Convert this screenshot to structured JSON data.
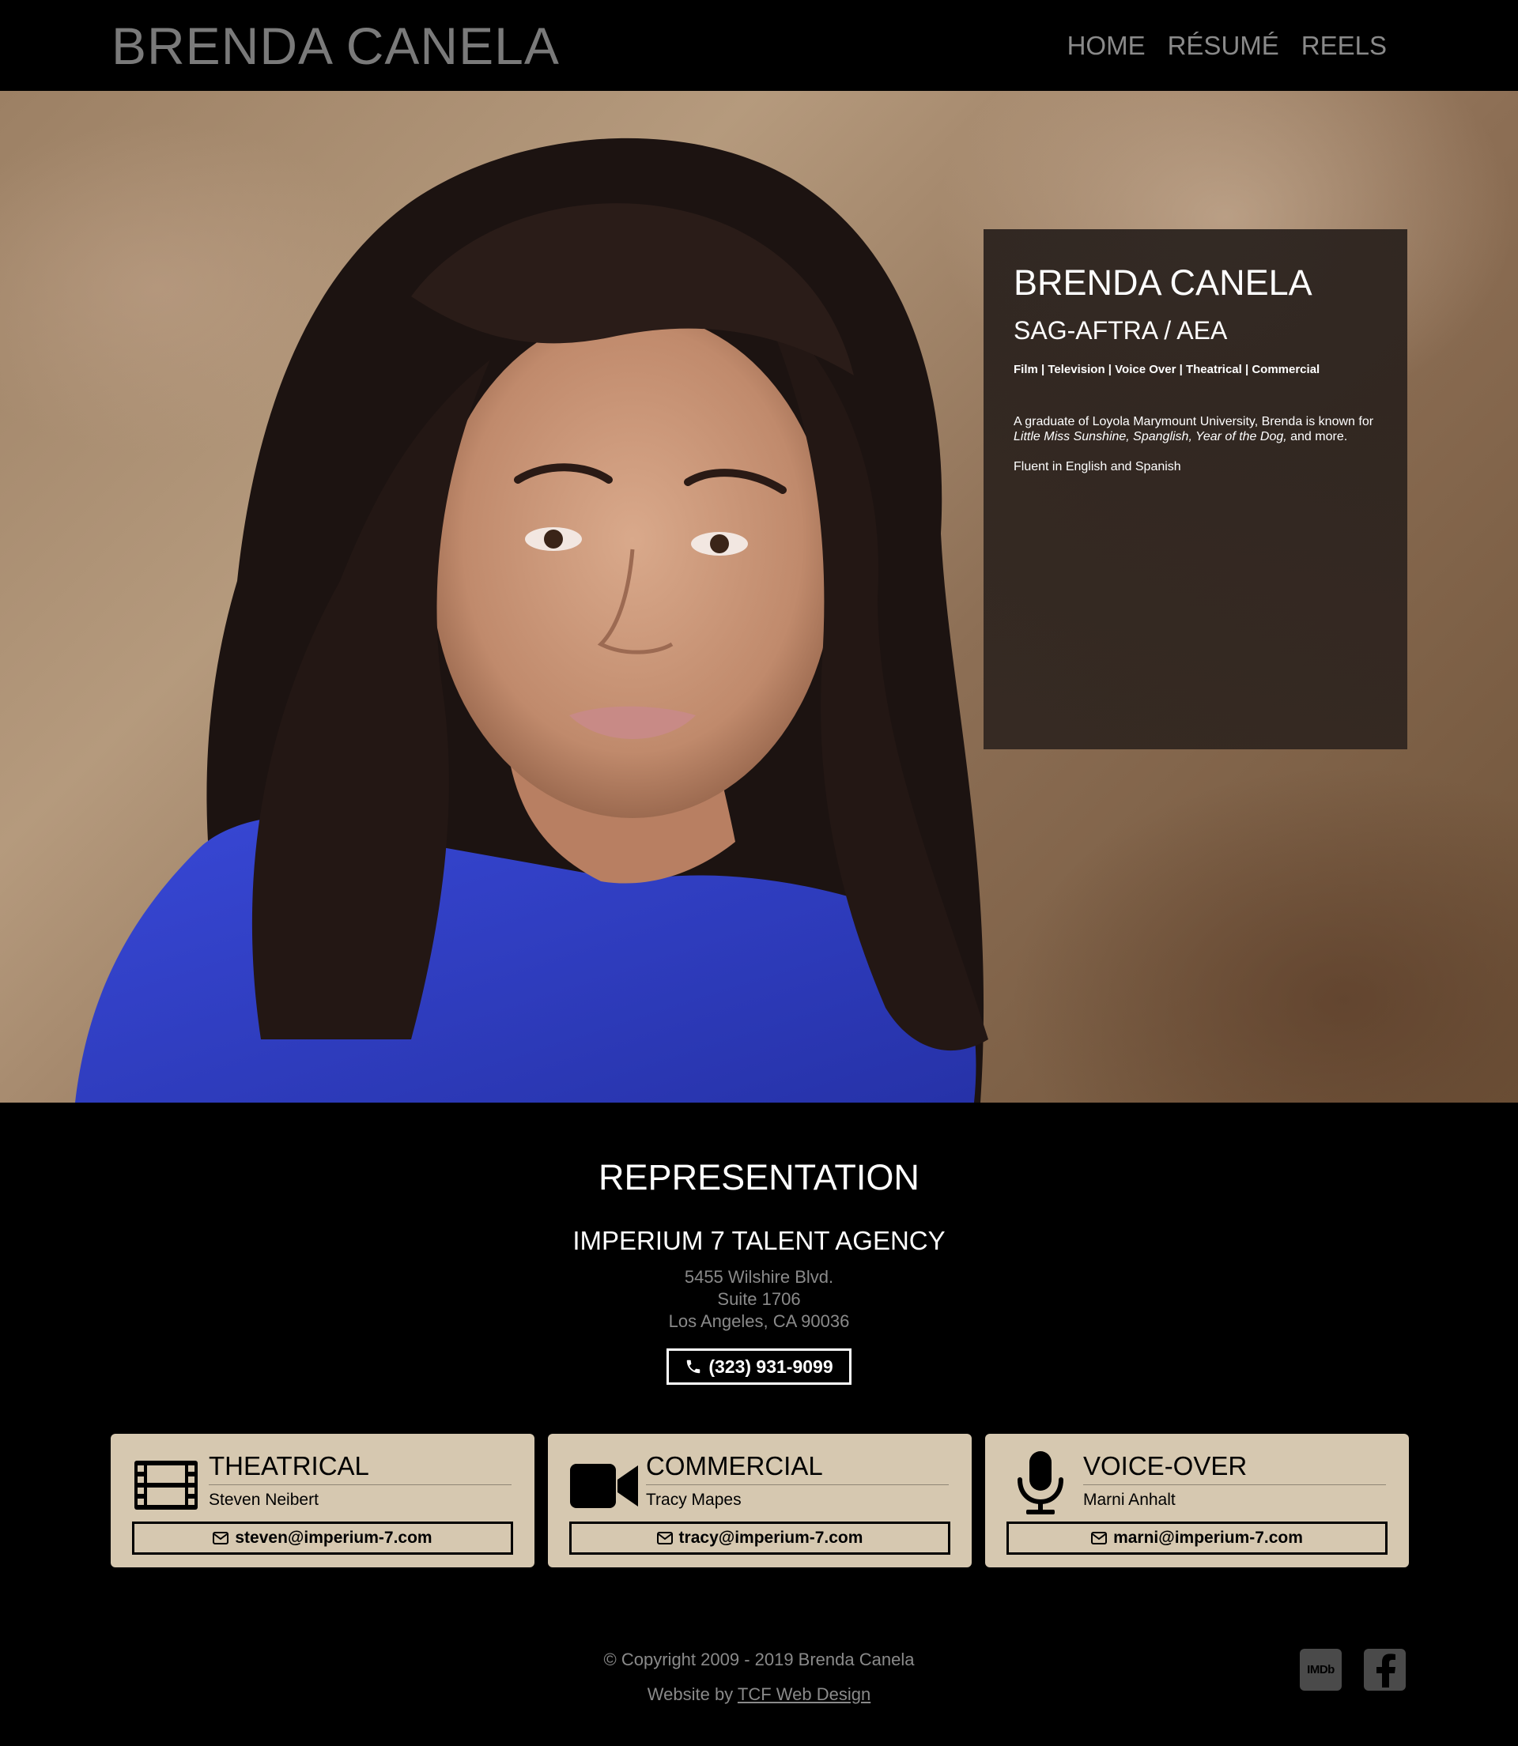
{
  "header": {
    "site_title": "BRENDA CANELA",
    "nav": [
      {
        "label": "HOME"
      },
      {
        "label": "RÉSUMÉ"
      },
      {
        "label": "REELS"
      }
    ]
  },
  "hero": {
    "photo_alt": "Headshot of Brenda Canela",
    "card": {
      "name": "BRENDA CANELA",
      "unions": "SAG-AFTRA / AEA",
      "categories": "Film | Television | Voice Over | Theatrical | Commercial",
      "bio_prefix": "A graduate of Loyola Marymount University, Brenda is known for ",
      "bio_titles": "Little Miss Sunshine, Spanglish, Year of the Dog,",
      "bio_suffix": " and more.",
      "languages": "Fluent in English and Spanish"
    }
  },
  "representation": {
    "heading": "REPRESENTATION",
    "agency": "IMPERIUM 7 TALENT AGENCY",
    "address": [
      "5455 Wilshire Blvd.",
      "Suite 1706",
      "Los Angeles, CA 90036"
    ],
    "phone": "(323) 931-9099",
    "cards": [
      {
        "title": "THEATRICAL",
        "agent": "Steven Neibert",
        "email": "steven@imperium-7.com",
        "icon": "film-icon"
      },
      {
        "title": "COMMERCIAL",
        "agent": "Tracy Mapes",
        "email": "tracy@imperium-7.com",
        "icon": "video-camera-icon"
      },
      {
        "title": "VOICE-OVER",
        "agent": "Marni Anhalt",
        "email": "marni@imperium-7.com",
        "icon": "microphone-icon"
      }
    ]
  },
  "footer": {
    "copyright": "© Copyright 2009 - 2019 Brenda Canela",
    "credit_prefix": "Website by ",
    "credit_link": "TCF Web Design",
    "social": [
      {
        "label": "IMDb",
        "icon": "imdb-icon"
      },
      {
        "label": "f",
        "icon": "facebook-icon"
      }
    ]
  },
  "colors": {
    "background": "#000000",
    "nav_text": "#8a8a8a",
    "card_bg": "#d6c8b0",
    "info_card_bg": "#2d231e",
    "shirt_blue": "#2f3fc4"
  }
}
